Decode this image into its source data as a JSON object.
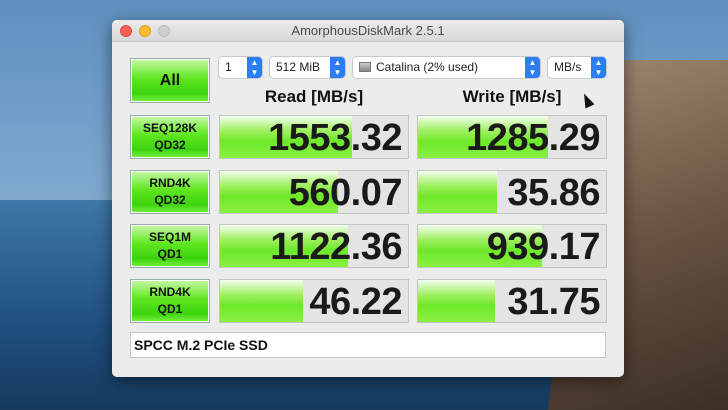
{
  "window": {
    "title": "AmorphousDiskMark 2.5.1"
  },
  "controls": {
    "all_label": "All",
    "count": "1",
    "size": "512 MiB",
    "disk": "Catalina (2% used)",
    "unit": "MB/s"
  },
  "headers": {
    "read": "Read [MB/s]",
    "write": "Write [MB/s]"
  },
  "tests": [
    {
      "line1": "SEQ128K",
      "line2": "QD32",
      "read": "1553.32",
      "write": "1285.29",
      "read_fill": 0.7,
      "write_fill": 0.69
    },
    {
      "line1": "RND4K",
      "line2": "QD32",
      "read": "560.07",
      "write": "35.86",
      "read_fill": 0.63,
      "write_fill": 0.42
    },
    {
      "line1": "SEQ1M",
      "line2": "QD1",
      "read": "1122.36",
      "write": "939.17",
      "read_fill": 0.68,
      "write_fill": 0.66
    },
    {
      "line1": "RND4K",
      "line2": "QD1",
      "read": "46.22",
      "write": "31.75",
      "read_fill": 0.44,
      "write_fill": 0.41
    }
  ],
  "footer": {
    "device": "SPCC M.2 PCIe SSD"
  }
}
